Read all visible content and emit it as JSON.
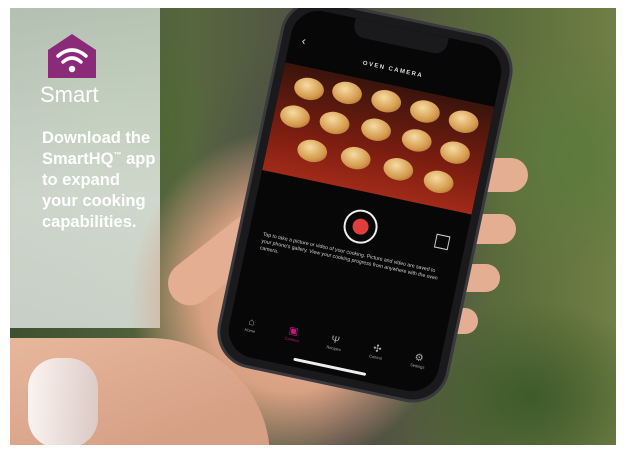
{
  "brand": {
    "logo_icon": "wifi-house-icon",
    "logo_color": "#8c2a7a",
    "name": "Smart"
  },
  "promo": {
    "line1": "Download the",
    "line2_prefix": "SmartHQ",
    "line2_tm": "™",
    "line2_suffix": " app",
    "line3": "to expand",
    "line4": "your cooking",
    "line5": "capabilities."
  },
  "phone": {
    "screen_title": "OVEN CAMERA",
    "back_icon": "chevron-left-icon",
    "record_icon": "record-icon",
    "expand_icon": "expand-icon",
    "accent_color": "#c9177e",
    "description": "Tap to take a picture or video of your cooking. Picture and video are saved to your phone's gallery. View your cooking progress from anywhere with the oven camera.",
    "tabs": [
      {
        "icon": "home-icon",
        "label": "Home",
        "active": false
      },
      {
        "icon": "camera-icon",
        "label": "Camera",
        "active": true
      },
      {
        "icon": "recipes-icon",
        "label": "Recipes",
        "active": false
      },
      {
        "icon": "control-icon",
        "label": "Control",
        "active": false
      },
      {
        "icon": "settings-icon",
        "label": "Settings",
        "active": false
      }
    ]
  }
}
